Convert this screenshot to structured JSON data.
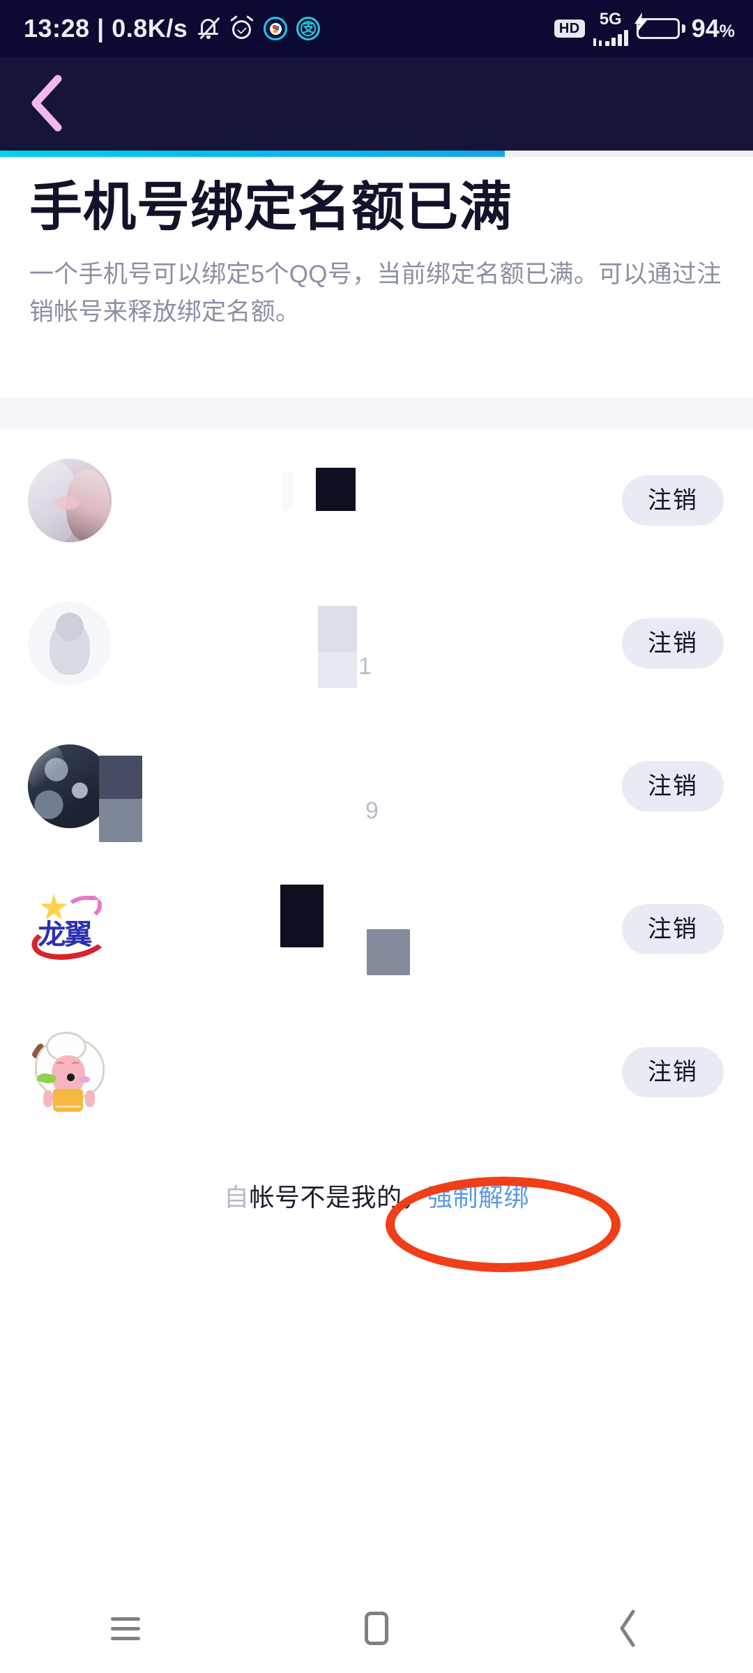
{
  "status_bar": {
    "time": "13:28",
    "separator": "|",
    "network_speed": "0.8K/s",
    "icons": [
      "mute-bell-icon",
      "alarm-clock-icon",
      "app-circle-icon",
      "alipay-circle-icon"
    ],
    "alipay_glyph": "支",
    "hd_badge": "HD",
    "network_type": "5G",
    "battery_percent": "94",
    "battery_percent_symbol": "%",
    "battery_charging": true,
    "background_color": "#0a0a32"
  },
  "appbar": {
    "back_icon": "chevron-left-icon",
    "back_icon_color": "#f2b8e8",
    "background_color": "#161539"
  },
  "progress": {
    "value_percent": 67,
    "start_color": "#00d2e8",
    "end_color": "#10a6f0",
    "track_color": "#efefef"
  },
  "headline": {
    "title": "手机号绑定名额已满",
    "description": "一个手机号可以绑定5个QQ号，当前绑定名额已满。可以通过注销帐号来释放绑定名额。"
  },
  "accounts": {
    "button_label": "注销",
    "button_bg": "#e8eaf4",
    "rows": [
      {
        "avatar": "anime-couple-avatar",
        "nickname": "",
        "uin": "",
        "redacted": true
      },
      {
        "avatar": "default-qq-penguin-avatar",
        "nickname": "",
        "uin": "1",
        "redacted": true
      },
      {
        "avatar": "earth-photo-avatar",
        "nickname": "",
        "uin": "9",
        "redacted": true
      },
      {
        "avatar": "longyi-brand-avatar",
        "nickname": "",
        "uin": "",
        "redacted": true,
        "brand_text": "龙翼"
      },
      {
        "avatar": "cartoon-sheep-avatar",
        "nickname": "",
        "uin": "",
        "redacted": true
      }
    ]
  },
  "footer": {
    "lead_text": "自",
    "plain_text": "帐号不是我的，",
    "link_text": "强制解绑",
    "link_color": "#5a9ae8",
    "annotation_color": "#f03e18"
  },
  "navbar": {
    "recents_icon": "menu-lines-icon",
    "home_icon": "home-square-icon",
    "back_icon": "chevron-left-icon",
    "icon_color": "#808080"
  }
}
